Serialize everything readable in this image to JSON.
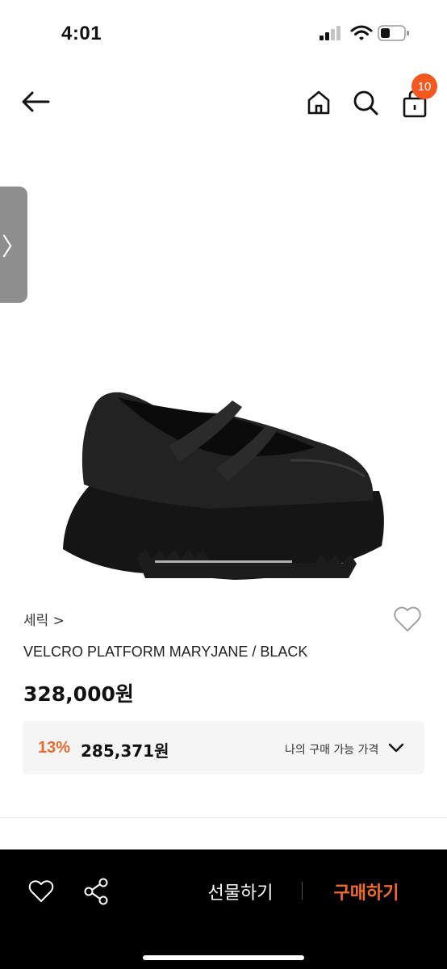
{
  "status_bar": {
    "time": "4:01"
  },
  "nav": {
    "cart_count": "10",
    "icons": [
      "arrow-left-icon",
      "home-icon",
      "search-icon",
      "shopping-bag-icon"
    ]
  },
  "side_tab": {
    "glyph": "〉"
  },
  "product": {
    "brand": "세릭 >",
    "name": "VELCRO PLATFORM MARYJANE / BLACK",
    "price": "328,000원",
    "discount_rate": "13%",
    "discount_price": "285,371원",
    "my_price_label": "나의 구매 가능 가격"
  },
  "bottom_bar": {
    "gift_label": "선물하기",
    "buy_label": "구매하기"
  },
  "colors": {
    "accent": "#f2581f",
    "discount": "#e8692c",
    "buy": "#f26a2e",
    "bottom_bar_bg": "#000000"
  }
}
